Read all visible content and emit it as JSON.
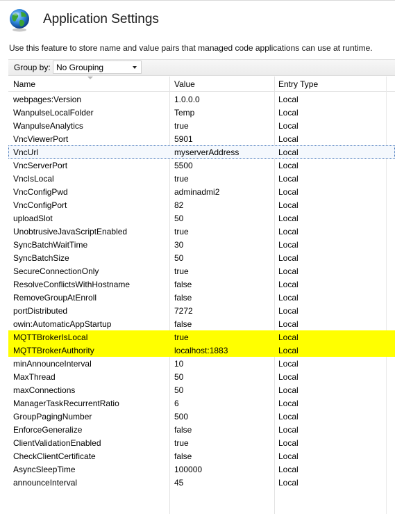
{
  "header": {
    "title": "Application Settings",
    "description": "Use this feature to store name and value pairs that managed code applications can use at runtime.",
    "icon": "globe-icon"
  },
  "toolbar": {
    "group_by_label": "Group by:",
    "group_by_value": "No Grouping"
  },
  "columns": [
    "Name",
    "Value",
    "Entry Type"
  ],
  "rows": [
    {
      "name": "webpages:Version",
      "value": "1.0.0.0",
      "type": "Local"
    },
    {
      "name": "WanpulseLocalFolder",
      "value": "Temp",
      "type": "Local"
    },
    {
      "name": "WanpulseAnalytics",
      "value": "true",
      "type": "Local"
    },
    {
      "name": "VncViewerPort",
      "value": "5901",
      "type": "Local"
    },
    {
      "name": "VncUrl",
      "value": "myserverAddress",
      "type": "Local",
      "selected": true
    },
    {
      "name": "VncServerPort",
      "value": "5500",
      "type": "Local"
    },
    {
      "name": "VncIsLocal",
      "value": "true",
      "type": "Local"
    },
    {
      "name": "VncConfigPwd",
      "value": "adminadmi2",
      "type": "Local"
    },
    {
      "name": "VncConfigPort",
      "value": "82",
      "type": "Local"
    },
    {
      "name": "uploadSlot",
      "value": "50",
      "type": "Local"
    },
    {
      "name": "UnobtrusiveJavaScriptEnabled",
      "value": "true",
      "type": "Local"
    },
    {
      "name": "SyncBatchWaitTime",
      "value": "30",
      "type": "Local"
    },
    {
      "name": "SyncBatchSize",
      "value": "50",
      "type": "Local"
    },
    {
      "name": "SecureConnectionOnly",
      "value": "true",
      "type": "Local"
    },
    {
      "name": "ResolveConflictsWithHostname",
      "value": "false",
      "type": "Local"
    },
    {
      "name": "RemoveGroupAtEnroll",
      "value": "false",
      "type": "Local"
    },
    {
      "name": "portDistributed",
      "value": "7272",
      "type": "Local"
    },
    {
      "name": "owin:AutomaticAppStartup",
      "value": "false",
      "type": "Local"
    },
    {
      "name": "MQTTBrokerIsLocal",
      "value": "true",
      "type": "Local",
      "highlighted": true
    },
    {
      "name": "MQTTBrokerAuthority",
      "value": "localhost:1883",
      "type": "Local",
      "highlighted": true
    },
    {
      "name": "minAnnounceInterval",
      "value": "10",
      "type": "Local"
    },
    {
      "name": "MaxThread",
      "value": "50",
      "type": "Local"
    },
    {
      "name": "maxConnections",
      "value": "50",
      "type": "Local"
    },
    {
      "name": "ManagerTaskRecurrentRatio",
      "value": "6",
      "type": "Local"
    },
    {
      "name": "GroupPagingNumber",
      "value": "500",
      "type": "Local"
    },
    {
      "name": "EnforceGeneralize",
      "value": "false",
      "type": "Local"
    },
    {
      "name": "ClientValidationEnabled",
      "value": "true",
      "type": "Local"
    },
    {
      "name": "CheckClientCertificate",
      "value": "false",
      "type": "Local"
    },
    {
      "name": "AsyncSleepTime",
      "value": "100000",
      "type": "Local"
    },
    {
      "name": "announceInterval",
      "value": "45",
      "type": "Local"
    }
  ],
  "colors": {
    "highlight": "#ffff00",
    "selection_border": "#3b6fb6",
    "grid_line": "#e3e3e3"
  }
}
